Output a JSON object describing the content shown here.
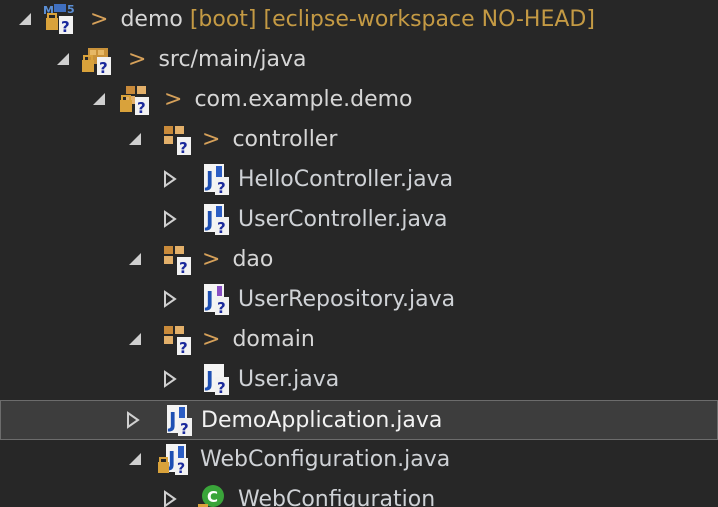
{
  "colors": {
    "background": "#272727",
    "text": "#d6d6d6",
    "chevron": "#d6a15a",
    "decoration": "#c49a44",
    "selection": "#3d3d3d"
  },
  "tree": {
    "project": {
      "name": "demo",
      "decoration": "[boot] [eclipse-workspace NO-HEAD]",
      "icon": "maven-project-icon",
      "state": "expanded"
    },
    "source_folder": {
      "name": "src/main/java",
      "icon": "source-folder-icon",
      "state": "expanded"
    },
    "package_root": {
      "name": "com.example.demo",
      "icon": "package-icon",
      "state": "expanded"
    },
    "pkg_controller": {
      "name": "controller",
      "icon": "package-icon",
      "state": "expanded"
    },
    "file_hello": {
      "name": "HelloController.java",
      "icon": "java-file-icon",
      "state": "collapsed"
    },
    "file_usercontroller": {
      "name": "UserController.java",
      "icon": "java-file-icon",
      "state": "collapsed"
    },
    "pkg_dao": {
      "name": "dao",
      "icon": "package-icon",
      "state": "expanded"
    },
    "file_userrepo": {
      "name": "UserRepository.java",
      "icon": "java-interface-file-icon",
      "state": "collapsed"
    },
    "pkg_domain": {
      "name": "domain",
      "icon": "package-icon",
      "state": "expanded"
    },
    "file_user": {
      "name": "User.java",
      "icon": "java-file-icon",
      "state": "collapsed"
    },
    "file_demoapp": {
      "name": "DemoApplication.java",
      "icon": "java-file-icon",
      "state": "collapsed",
      "selected": true
    },
    "file_webconfig": {
      "name": "WebConfiguration.java",
      "icon": "java-file-icon",
      "state": "expanded"
    },
    "class_webconfig": {
      "name": "WebConfiguration",
      "icon": "class-icon",
      "state": "collapsed"
    }
  }
}
